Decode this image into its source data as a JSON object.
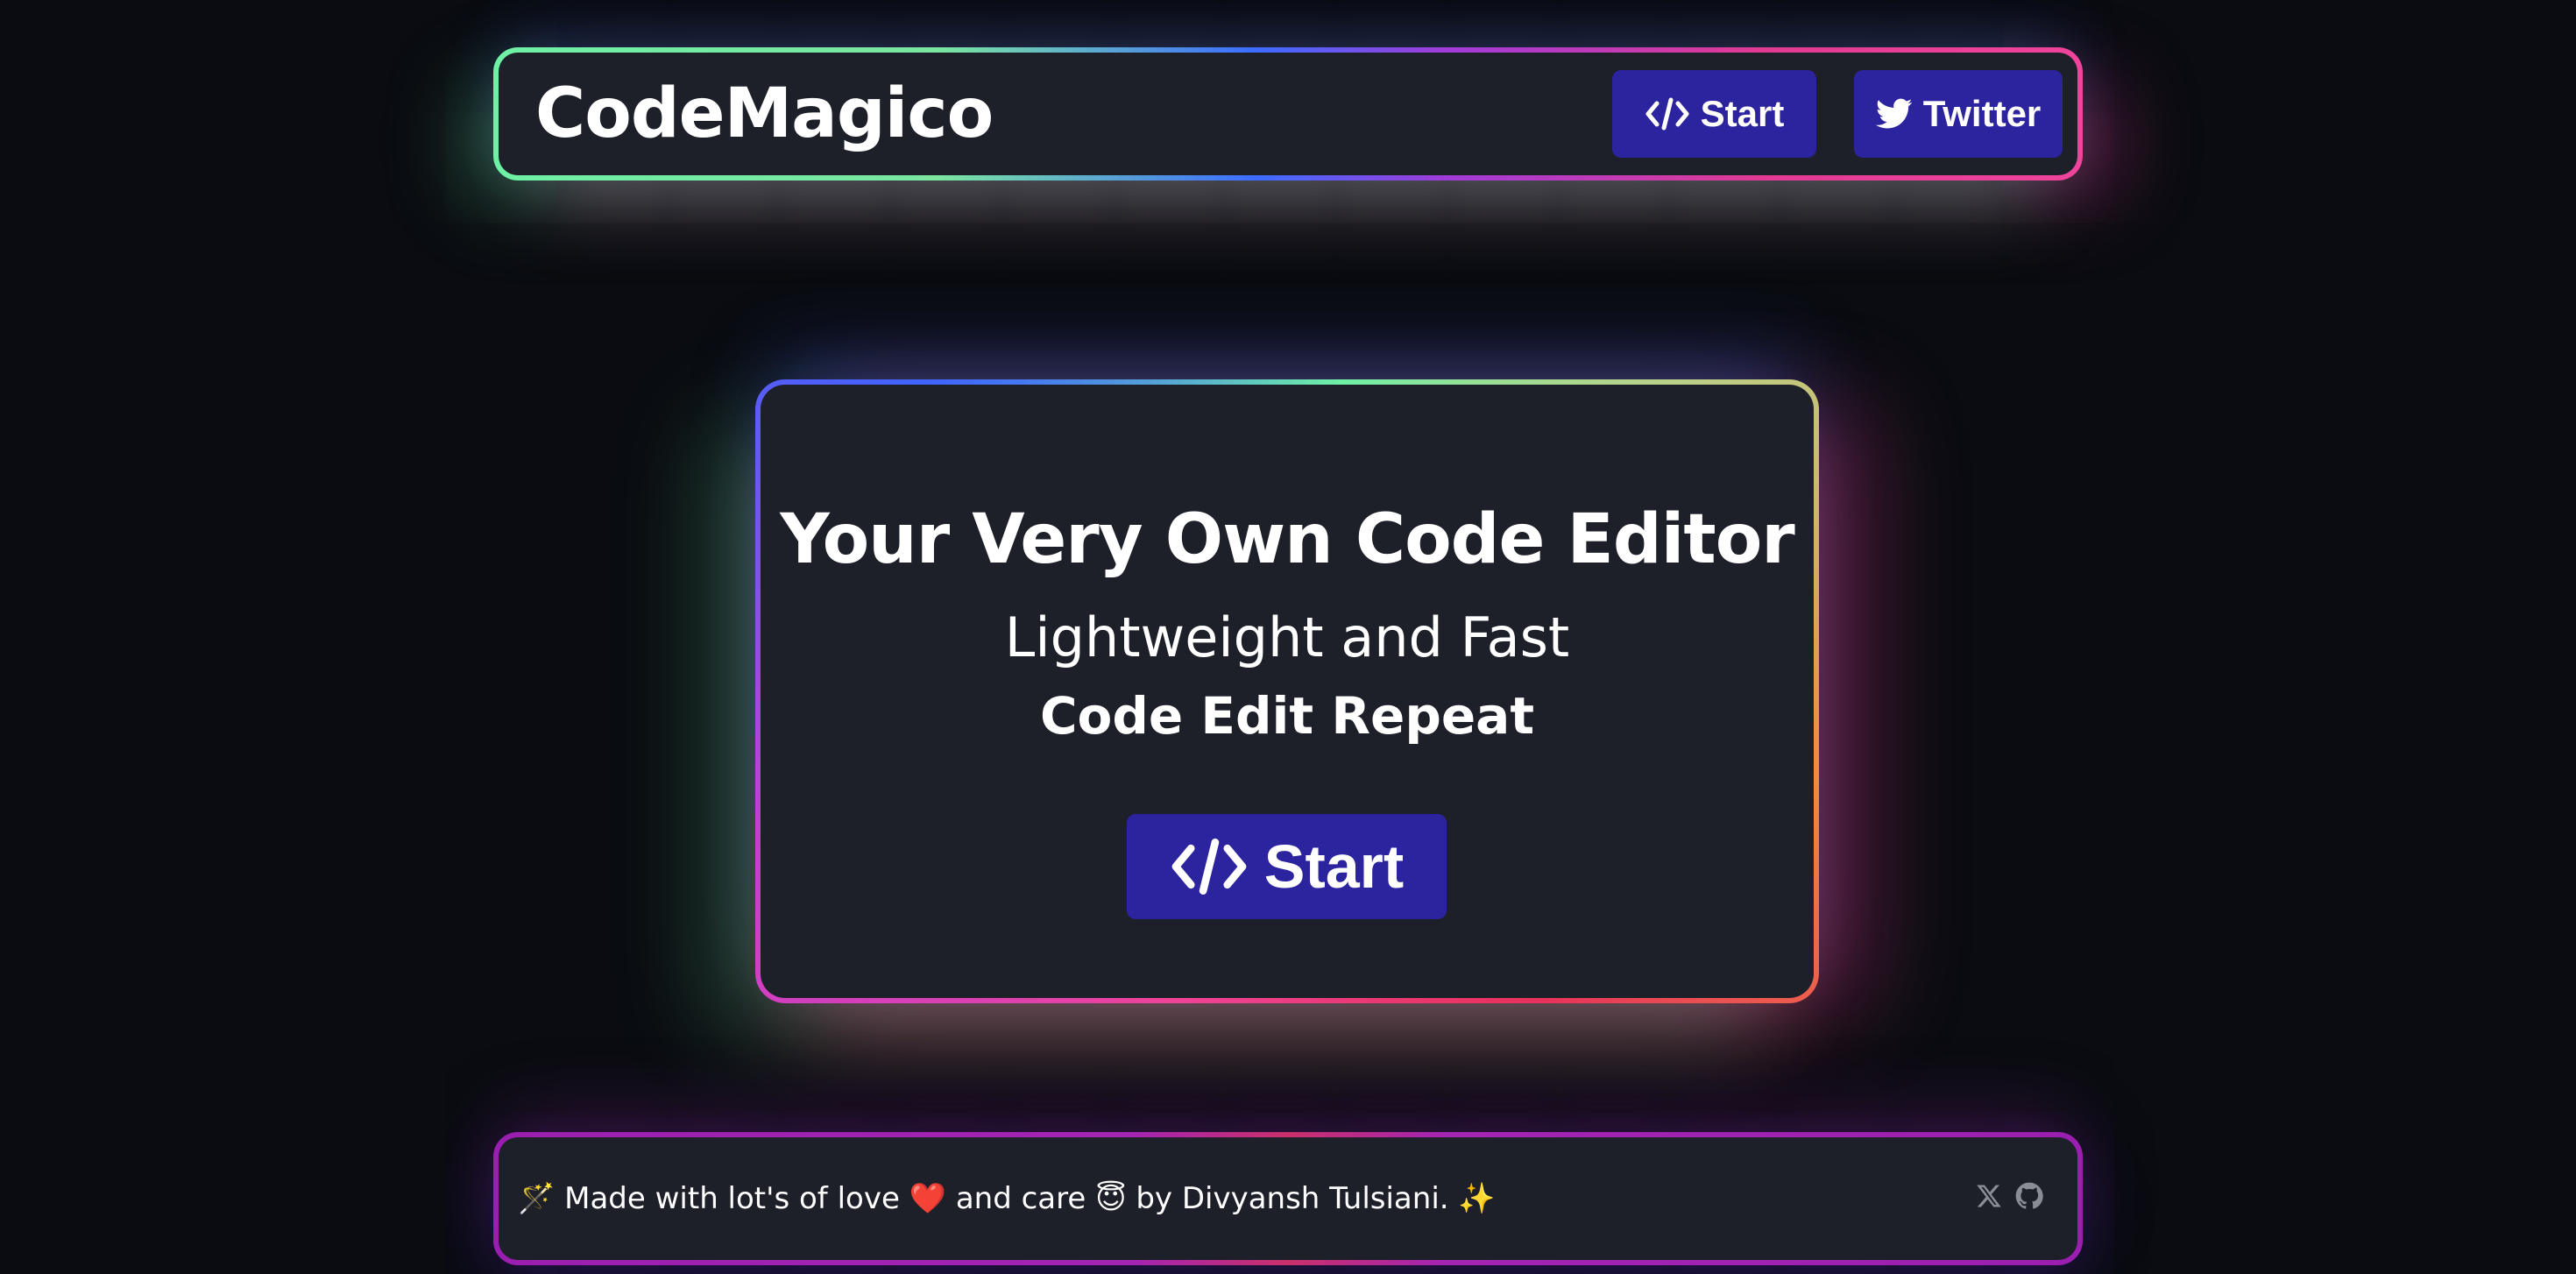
{
  "header": {
    "brand": "CodeMagico",
    "nav": {
      "start_label": "Start",
      "twitter_label": "Twitter"
    }
  },
  "hero": {
    "title": "Your Very Own Code Editor",
    "subtitle": "Lightweight and Fast",
    "tagline": "Code Edit Repeat",
    "cta_label": "Start"
  },
  "footer": {
    "text": "🪄 Made with lot's of love ❤️ and care 😇 by Divyansh Tulsiani. ✨",
    "icons": [
      "x-icon",
      "github-icon"
    ]
  },
  "colors": {
    "background": "#0a0c11",
    "panel": "#1d1f29",
    "button": "#2c239e",
    "glow_green": "#6ef0a5",
    "glow_pink": "#f04398",
    "glow_blue": "#3f63ff",
    "footer_border": "#9a1fb0"
  }
}
